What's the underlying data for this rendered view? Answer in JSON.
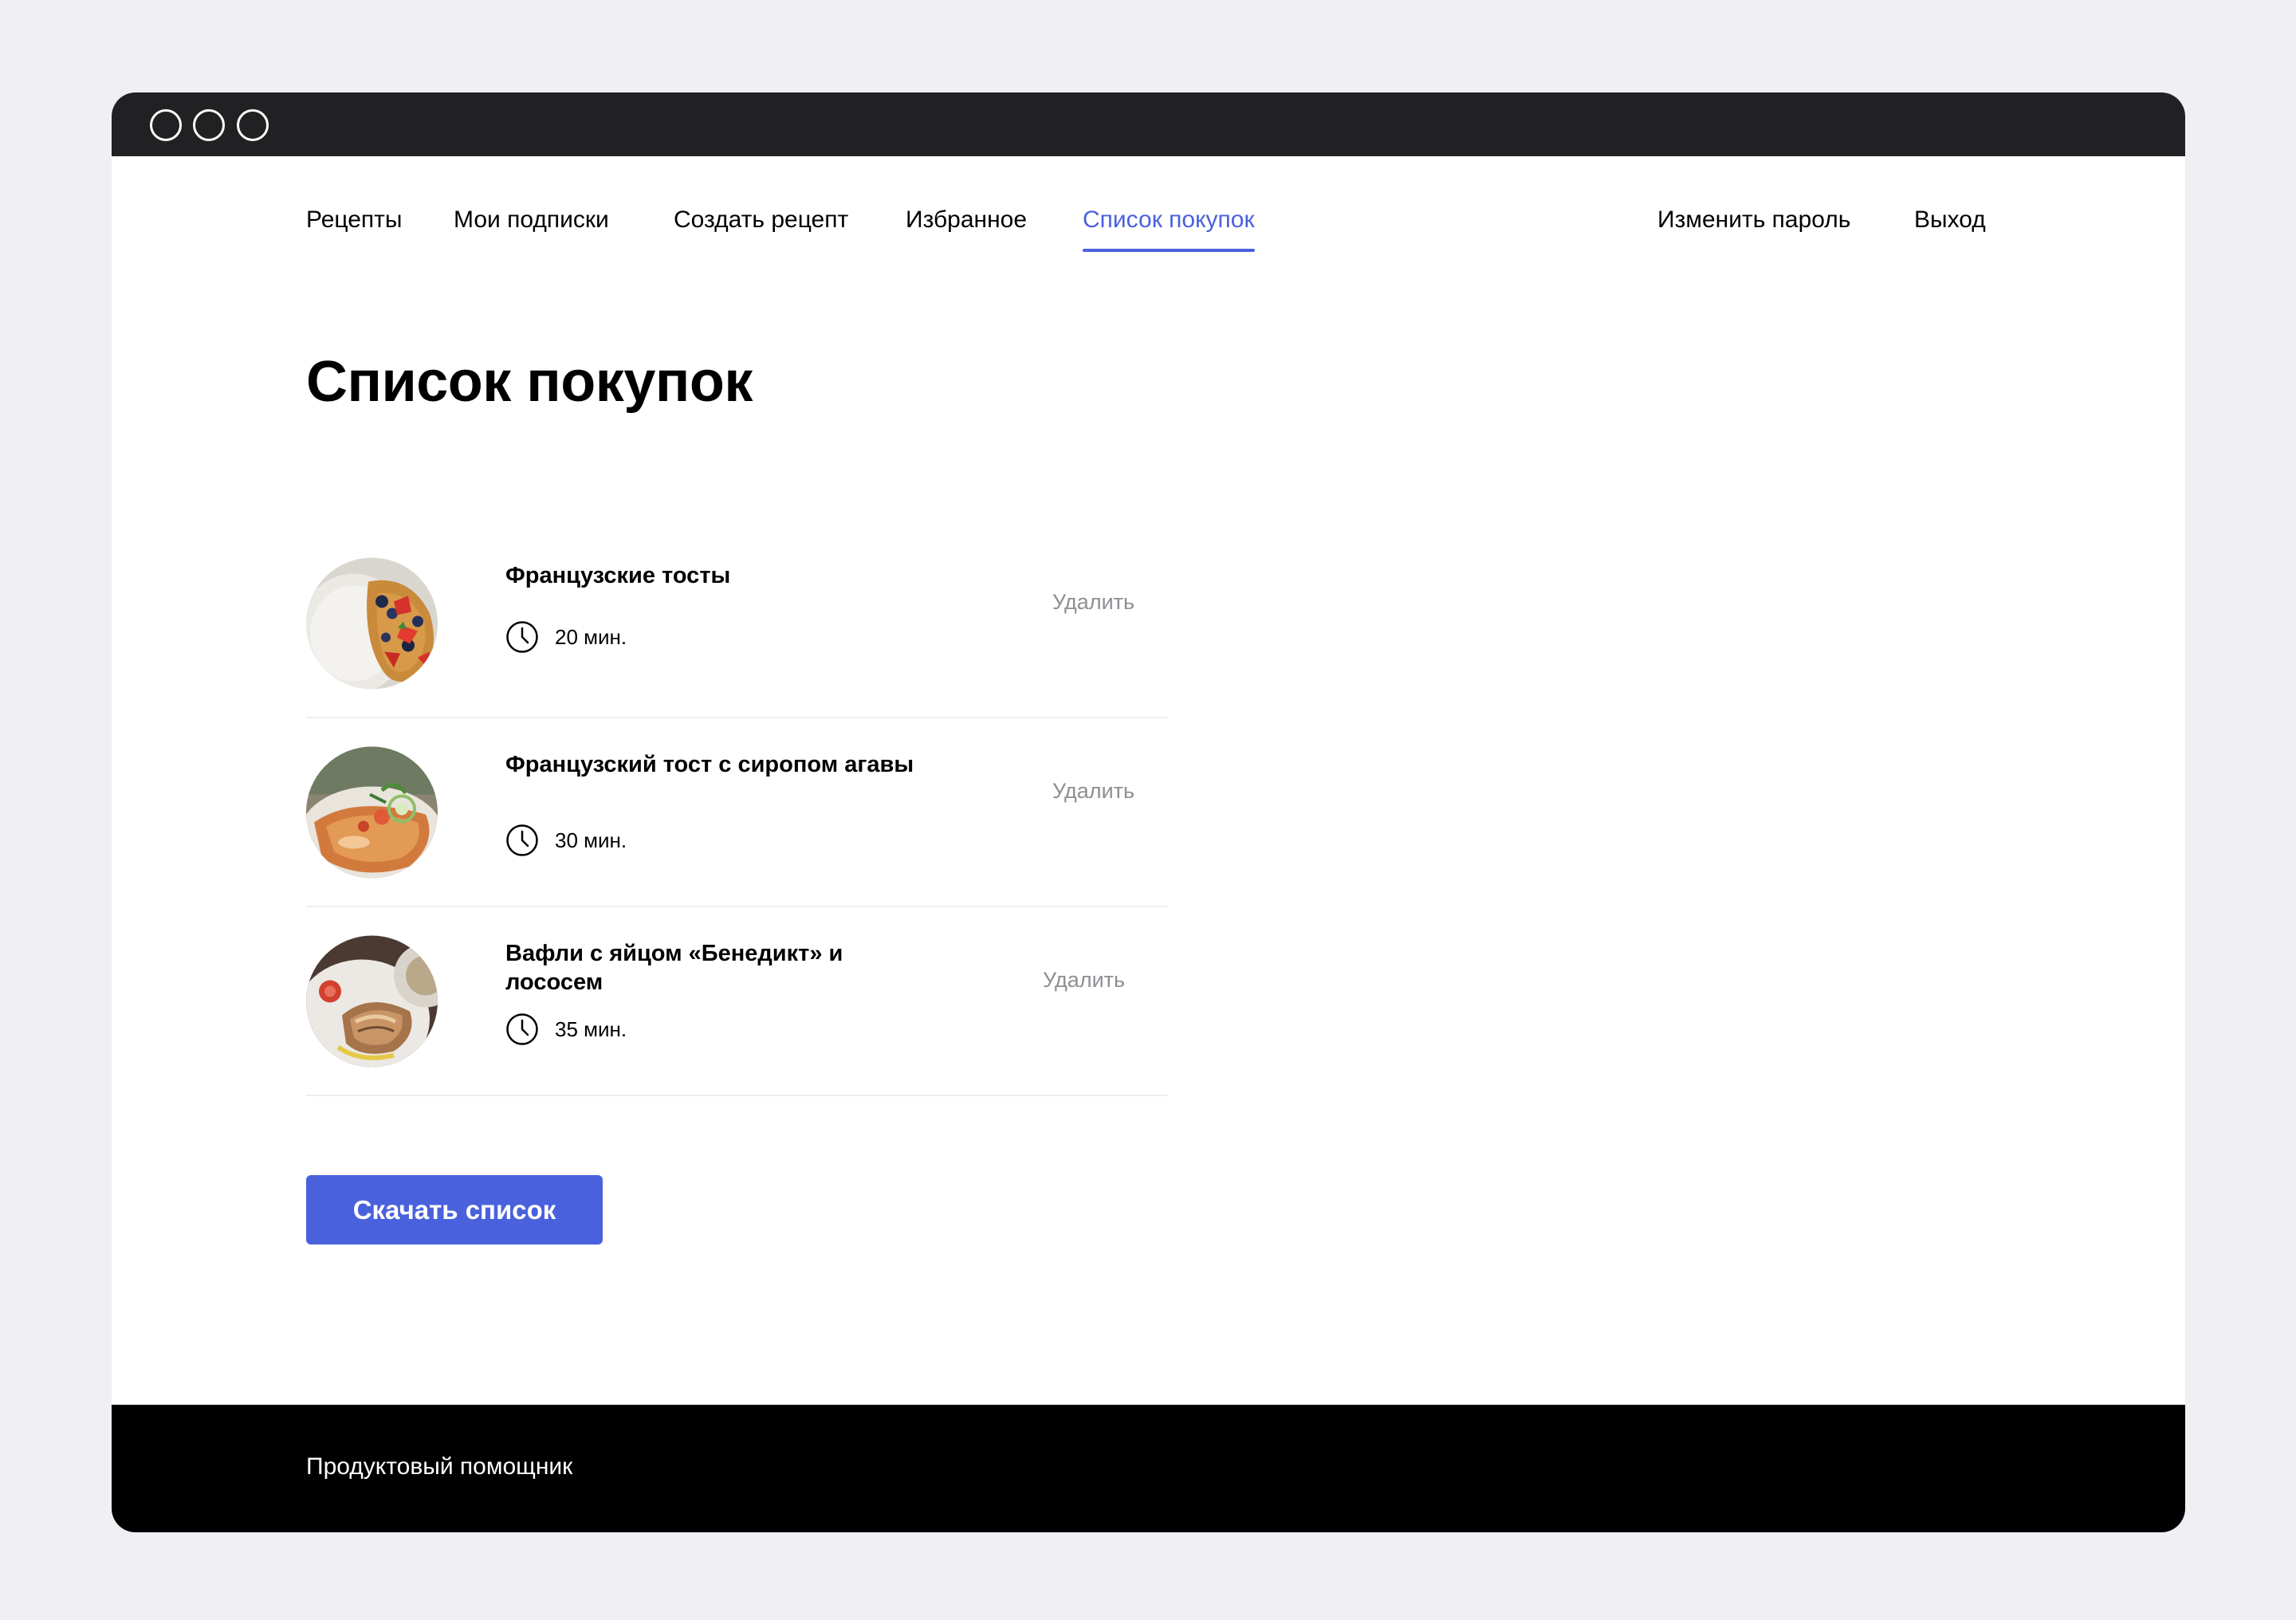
{
  "nav": {
    "items": [
      {
        "label": "Рецепты"
      },
      {
        "label": "Мои подписки"
      },
      {
        "label": "Создать рецепт"
      },
      {
        "label": "Избранное"
      },
      {
        "label": "Список покупок",
        "active": true
      }
    ],
    "right": [
      {
        "label": "Изменить пароль"
      },
      {
        "label": "Выход"
      }
    ]
  },
  "page": {
    "title": "Список покупок"
  },
  "recipes": [
    {
      "title": "Французские тосты",
      "time": "20 мин.",
      "delete_label": "Удалить"
    },
    {
      "title": "Французский тост с сиропом агавы",
      "time": "30 мин.",
      "delete_label": "Удалить"
    },
    {
      "title": "Вафли с яйцом «Бенедикт» и лососем",
      "time": "35 мин.",
      "delete_label": "Удалить"
    }
  ],
  "download_button": {
    "label": "Скачать список"
  },
  "footer": {
    "text": "Продуктовый помощник"
  },
  "colors": {
    "accent": "#4a61dd",
    "titlebar": "#212124",
    "footer": "#000000",
    "muted": "#8e8e93"
  },
  "icons": {
    "time": "clock-icon"
  }
}
